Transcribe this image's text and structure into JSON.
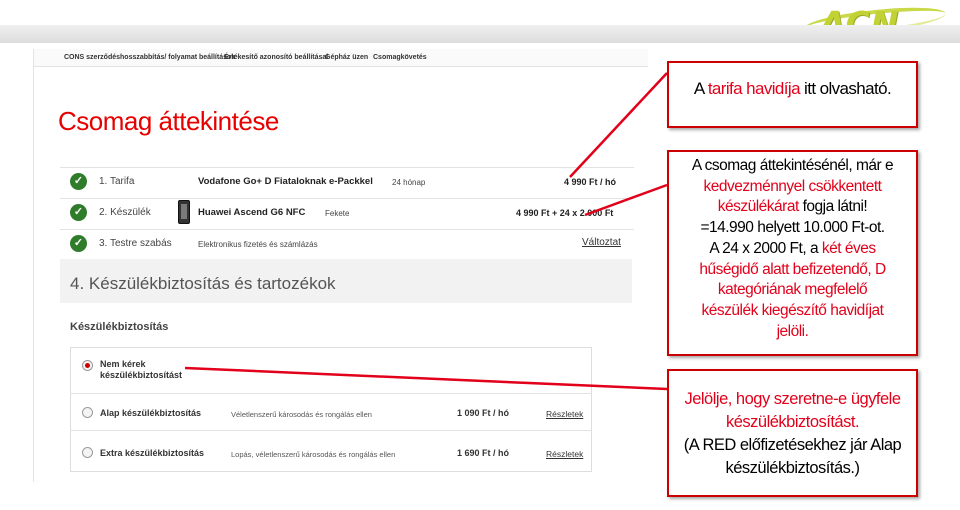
{
  "brand": {
    "logo_text": "ACN"
  },
  "nav": [
    {
      "label": "CONS szerződéshosszabbítás/ folyamat beállítások"
    },
    {
      "label": "Értékesítő azonosító beállításai"
    },
    {
      "label": "Gépház üzen"
    },
    {
      "label": "Csomagkövetés"
    }
  ],
  "page": {
    "title": "Csomag áttekintése"
  },
  "steps": [
    {
      "label": "1. Tarifa",
      "name": "Vodafone Go+ D Fiataloknak e-Packkel",
      "detail": "24 hónap",
      "price": "4 990 Ft / hó"
    },
    {
      "label": "2. Készülék",
      "name": "Huawei Ascend G6 NFC",
      "detail": "Fekete",
      "price": "4 990 Ft + 24 x 2 000 Ft"
    },
    {
      "label": "3. Testre szabás",
      "name": "Elektronikus fizetés és számlázás",
      "link": "Változtat"
    }
  ],
  "section4": {
    "title": "4. Készülékbiztosítás és tartozékok"
  },
  "insurance": {
    "heading": "Készülékbiztosítás",
    "options": [
      {
        "name": "Nem kérek készülékbiztosítást",
        "desc": "",
        "price": "",
        "link": "",
        "selected": true
      },
      {
        "name": "Alap készülékbiztosítás",
        "desc": "Véletlenszerű károsodás és rongálás ellen",
        "price": "1 090 Ft / hó",
        "link": "Részletek",
        "selected": false
      },
      {
        "name": "Extra készülékbiztosítás",
        "desc": "Lopás, véletlenszerű károsodás és rongálás ellen",
        "price": "1 690 Ft / hó",
        "link": "Részletek",
        "selected": false
      }
    ]
  },
  "callouts": {
    "c1": {
      "pre": "A ",
      "red": "tarifa havidíja",
      "post": " itt olvasható."
    },
    "c2": {
      "l1": "A csomag áttekintésénél, már e",
      "red1": "kedvezménnyel csökkentett",
      "red2": "készülékárat",
      "l3b": " fogja látni!",
      "l4": "=14.990 helyett 10.000 Ft-ot.",
      "l5a": "A 24 x 2000 Ft, a ",
      "red3": "két éves",
      "red4": "hűségidő alatt befizetendő, D",
      "red5": "kategóriának megfelelő",
      "red6": "készülék kiegészítő havidíjat",
      "red7": "jelöli."
    },
    "c3": {
      "red1": "Jelölje, hogy szeretne-e ügyfele",
      "red2": "készülékbiztosítást.",
      "l3": "(A RED előfizetésekhez jár Alap",
      "l4": "készülékbiztosítás.)"
    }
  },
  "colors": {
    "accent_red": "#e2001a",
    "check_green": "#2f7d2b",
    "logo_green": "#c2d235"
  }
}
